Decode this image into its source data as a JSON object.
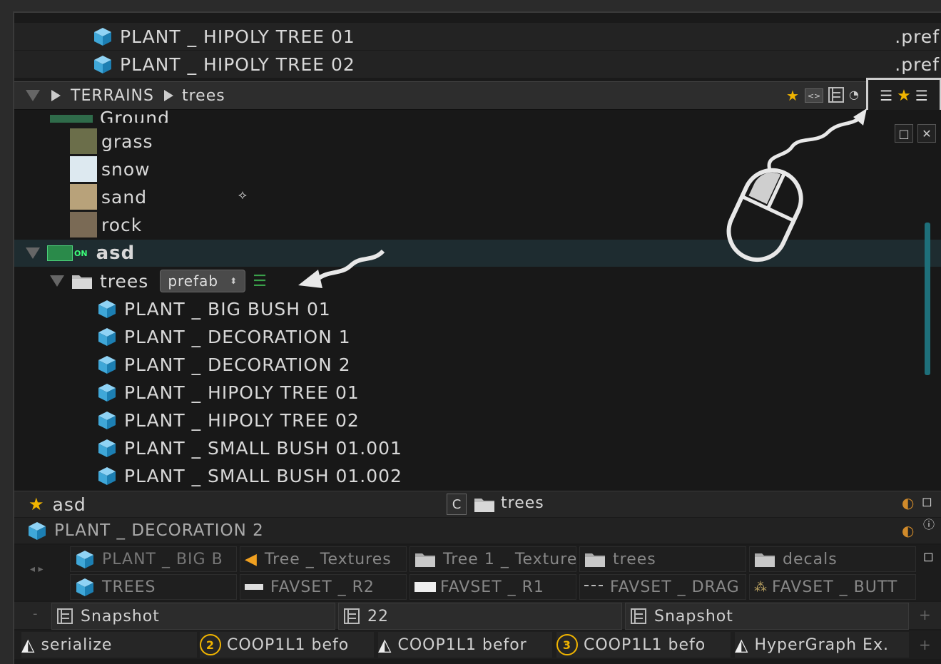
{
  "top_list": [
    {
      "label": "PLANT _ HIPOLY TREE 01",
      "ext": ".pref"
    },
    {
      "label": "PLANT _ HIPOLY TREE 02",
      "ext": ".pref"
    }
  ],
  "breadcrumb": {
    "root": "TERRAINS",
    "child": "trees"
  },
  "ground_label": "Ground",
  "textures": [
    {
      "label": "grass",
      "color": "#6b6e4a"
    },
    {
      "label": "snow",
      "color": "#dde9f0"
    },
    {
      "label": "sand",
      "color": "#b8a27a"
    },
    {
      "label": "rock",
      "color": "#7a6a55"
    }
  ],
  "group": {
    "label": "asd",
    "on_badge": "ON"
  },
  "folder": {
    "label": "trees",
    "dropdown": "prefab"
  },
  "items": [
    "PLANT _ BIG BUSH 01",
    "PLANT _ DECORATION 1",
    "PLANT _ DECORATION 2",
    "PLANT _ HIPOLY TREE 01",
    "PLANT _ HIPOLY TREE 02",
    "PLANT _ SMALL BUSH 01.001",
    "PLANT _ SMALL BUSH 01.002"
  ],
  "fav_bar": {
    "label": "asd",
    "c_button": "C",
    "path": "trees"
  },
  "selected": {
    "label": "PLANT _ DECORATION 2"
  },
  "favsets_row1": [
    "PLANT _ BIG B",
    "Tree _ Textures",
    "Tree 1 _ Texture",
    "trees",
    "decals"
  ],
  "favsets_row2": [
    "TREES",
    "FAVSET _ R2",
    "FAVSET _ R1",
    "FAVSET _ DRAG",
    "FAVSET _ BUTT"
  ],
  "snapshots": [
    "Snapshot",
    "22",
    "Snapshot"
  ],
  "scene_tabs": [
    {
      "label": "serialize",
      "num": ""
    },
    {
      "label": "COOP1L1 befo",
      "num": "2"
    },
    {
      "label": "COOP1L1 befor",
      "num": ""
    },
    {
      "label": "COOP1L1 befo",
      "num": "3"
    },
    {
      "label": "HyperGraph Ex.",
      "num": ""
    }
  ],
  "colors": {
    "accent_teal": "#1e6f7a",
    "cube_blue": "#3fa7d8",
    "star": "#f0b400"
  }
}
